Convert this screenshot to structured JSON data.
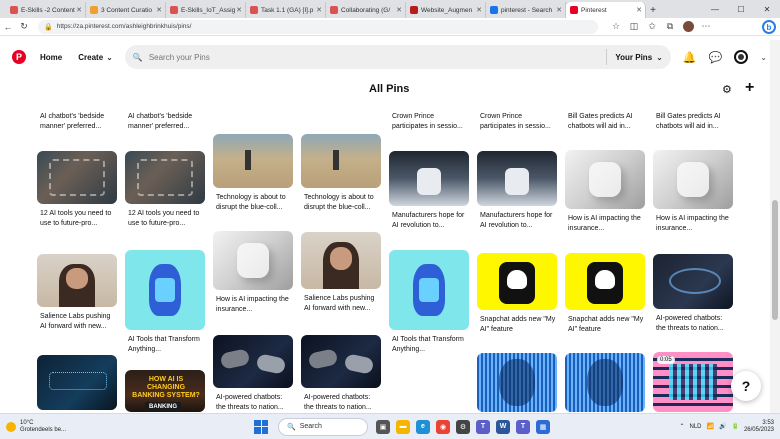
{
  "browser": {
    "tabs": [
      {
        "label": "E-Skills -2 Content",
        "color": "#d9534f"
      },
      {
        "label": "3 Content Curatio",
        "color": "#f0a030"
      },
      {
        "label": "E-Skills_IoT_Assig",
        "color": "#d9534f"
      },
      {
        "label": "Task 1.1 (GA) [I].p",
        "color": "#d9534f"
      },
      {
        "label": "Collaborating (G/",
        "color": "#d9534f"
      },
      {
        "label": "Website_Augmen",
        "color": "#b71c1c"
      },
      {
        "label": "pinterest - Search",
        "color": "#1a73e8"
      },
      {
        "label": "Pinterest",
        "color": "#e60023"
      }
    ],
    "url": "https://za.pinterest.com/ashleighbrinkhuis/pins/"
  },
  "header": {
    "home_label": "Home",
    "create_label": "Create",
    "search_placeholder": "Search your Pins",
    "scope_label": "Your Pins"
  },
  "page_title": "All Pins",
  "pins": {
    "top_captions": [
      "AI chatbot's 'bedside manner' preferred...",
      "AI chatbot's 'bedside manner' preferred...",
      "Crown Prince participates in sessio...",
      "Crown Prince participates in sessio...",
      "Bill Gates predicts AI chatbots will aid in...",
      "Bill Gates predicts AI chatbots will aid in..."
    ],
    "tools1": "12 AI tools you need to use to future-pro...",
    "tools2": "12 AI tools you need to use to future-pro...",
    "tech1": "Technology is about to disrupt the blue-coll...",
    "tech2": "Technology is about to disrupt the blue-coll...",
    "manu1": "Manufacturers hope for AI revolution to...",
    "manu2": "Manufacturers hope for AI revolution to...",
    "impact1": "How is AI impacting the insurance...",
    "impact2": "How is AI impacting the insurance...",
    "impact3": "How is AI impacting the insurance...",
    "salience1": "Salience Labs pushing AI forward with new...",
    "salience2": "Salience Labs pushing AI forward with new...",
    "tools_tr1": "AI Tools that Transform Anything...",
    "tools_tr2": "AI Tools that Transform Anything...",
    "snap1": "Snapchat adds new \"My AI\" feature",
    "snap2": "Snapchat adds new \"My AI\" feature",
    "threat1": "AI-powered chatbots: the threats to nation...",
    "threat2": "AI-powered chatbots: the threats to nation...",
    "threat3": "AI-powered chatbots: the threats to nation...",
    "banking_title": "HOW AI IS CHANGING BANKING SYSTEM?",
    "banking_sub": "BANKING",
    "video_badge": "0:05"
  },
  "help_label": "?",
  "taskbar": {
    "temp": "10°C",
    "weather": "Grotendeels be...",
    "search_label": "Search",
    "lang": "NLD",
    "time": "3:53",
    "date": "26/05/2023"
  }
}
